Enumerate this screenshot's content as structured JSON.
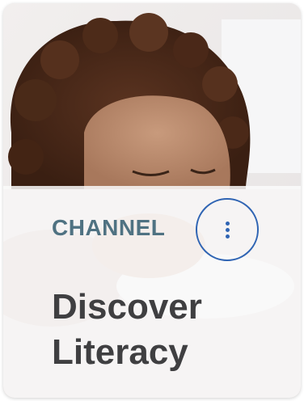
{
  "card": {
    "type_label": "CHANNEL",
    "title_line1": "Discover",
    "title_line2": "Literacy",
    "menu_icon": "more-vertical-icon",
    "colors": {
      "type_label": "#4f7282",
      "accent_ring": "#2f64b3",
      "title": "#3f3f41"
    }
  }
}
